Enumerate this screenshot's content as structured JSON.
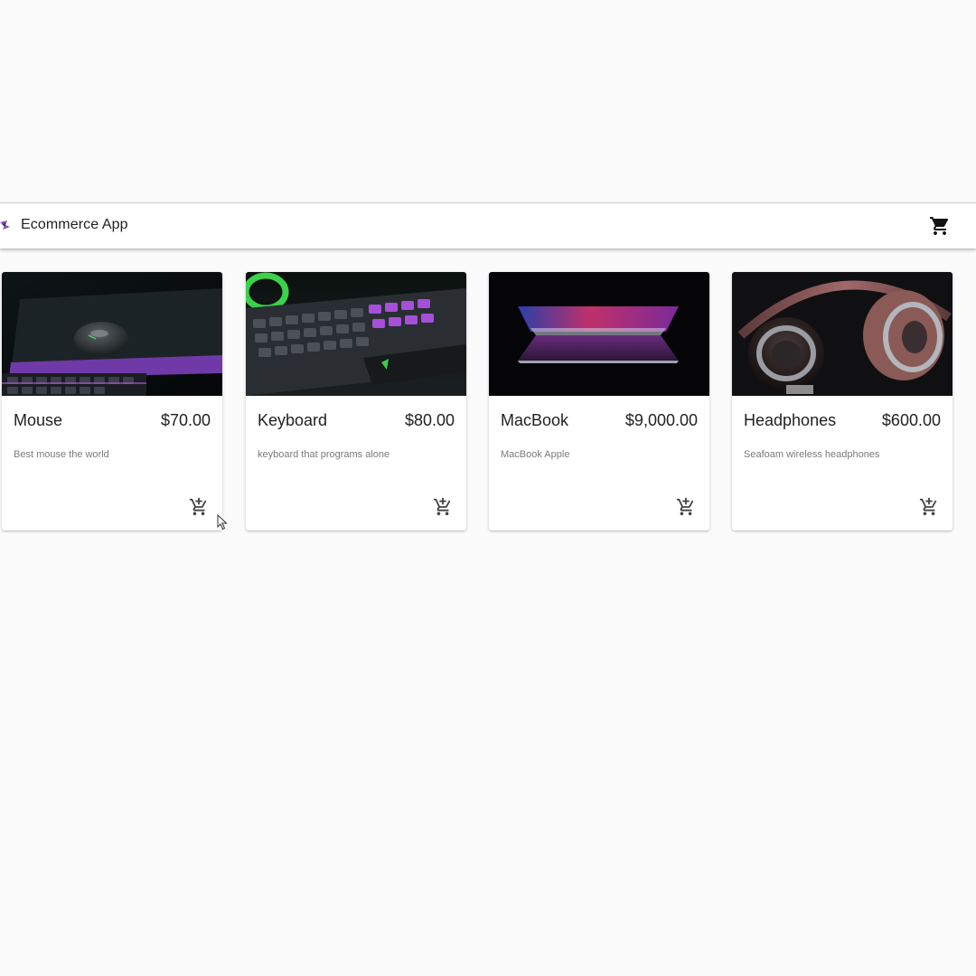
{
  "app": {
    "title": "Ecommerce App",
    "logo_icon": "ecommerce-logo-icon",
    "cart_icon": "shopping-cart-icon"
  },
  "products": [
    {
      "name": "Mouse",
      "price": "$70.00",
      "description": "Best mouse the world",
      "image_icon": "gaming-mouse-image",
      "add_icon": "add-shopping-cart-icon"
    },
    {
      "name": "Keyboard",
      "price": "$80.00",
      "description": "keyboard that programs alone",
      "image_icon": "gaming-keyboard-image",
      "add_icon": "add-shopping-cart-icon"
    },
    {
      "name": "MacBook",
      "price": "$9,000.00",
      "description": "MacBook Apple",
      "image_icon": "macbook-image",
      "add_icon": "add-shopping-cart-icon"
    },
    {
      "name": "Headphones",
      "price": "$600.00",
      "description": "Seafoam wireless headphones",
      "image_icon": "headphones-image",
      "add_icon": "add-shopping-cart-icon"
    }
  ],
  "colors": {
    "background": "#fcfbfc",
    "appbar": "#ffffff",
    "text": "#222222",
    "muted_text": "#7a7a7a",
    "logo_accent": "#7b4fb0"
  }
}
